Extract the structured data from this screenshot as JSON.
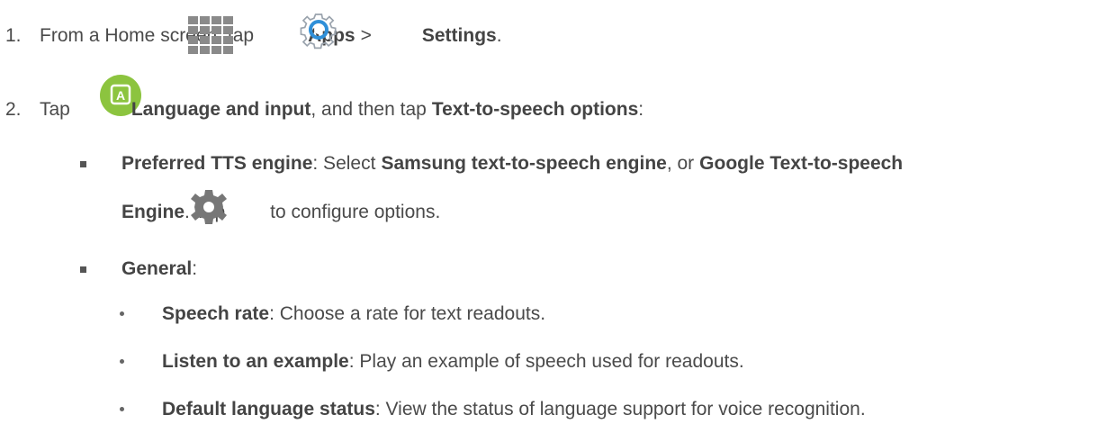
{
  "step1": {
    "number": "1.",
    "text_before": "From a Home screen, tap",
    "apps_label": "Apps",
    "separator": ">",
    "settings_label": "Settings",
    "period": "."
  },
  "step2": {
    "number": "2.",
    "tap": "Tap",
    "language_label": "Language and input",
    "middle": ", and then tap",
    "tts_label": "Text-to-speech options",
    "colon": ":"
  },
  "tts_engine": {
    "label": "Preferred TTS engine",
    "text1": ": Select",
    "samsung": "Samsung text-to-speech engine",
    "or": ", or",
    "google": "Google Text-to-speech",
    "engine": "Engine",
    "tap": ". Tap",
    "configure": "to configure options."
  },
  "general": {
    "label": "General",
    "colon": ":"
  },
  "items": [
    {
      "label": "Speech rate",
      "text": ": Choose a rate for text readouts."
    },
    {
      "label": "Listen to an example",
      "text": ": Play an example of speech used for readouts."
    },
    {
      "label": "Default language status",
      "text": ": View the status of language support for voice recognition."
    }
  ],
  "icons": {
    "apps": "apps-grid-icon",
    "settings": "settings-gear-icon",
    "language": "language-input-icon",
    "configure": "configure-gear-icon"
  },
  "colors": {
    "text": "#4a4a4a",
    "language_icon": "#8cc43f",
    "settings_ring": "#2f8fd8"
  }
}
